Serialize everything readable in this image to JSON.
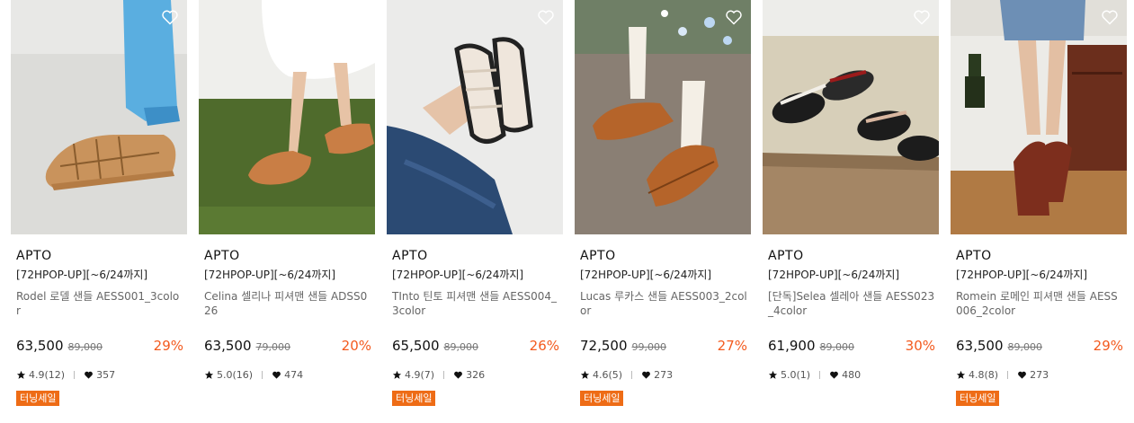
{
  "products": [
    {
      "brand": "APTO",
      "promo": "[72HPOP-UP][~6/24까지]",
      "name": "Rodel 로델 샌들 AESS001_3color",
      "price": "63,500",
      "original_price": "89,000",
      "discount": "29%",
      "rating": "4.9(12)",
      "likes": "357",
      "badge": "터닝세일"
    },
    {
      "brand": "APTO",
      "promo": "[72HPOP-UP][~6/24까지]",
      "name": "Celina 셀리나 피셔맨 샌들 ADSS026",
      "price": "63,500",
      "original_price": "79,000",
      "discount": "20%",
      "rating": "5.0(16)",
      "likes": "474",
      "badge": ""
    },
    {
      "brand": "APTO",
      "promo": "[72HPOP-UP][~6/24까지]",
      "name": "TInto 틴토 피셔맨 샌들 AESS004_3color",
      "price": "65,500",
      "original_price": "89,000",
      "discount": "26%",
      "rating": "4.9(7)",
      "likes": "326",
      "badge": "터닝세일"
    },
    {
      "brand": "APTO",
      "promo": "[72HPOP-UP][~6/24까지]",
      "name": "Lucas 루카스 샌들 AESS003_2color",
      "price": "72,500",
      "original_price": "99,000",
      "discount": "27%",
      "rating": "4.6(5)",
      "likes": "273",
      "badge": "터닝세일"
    },
    {
      "brand": "APTO",
      "promo": "[72HPOP-UP][~6/24까지]",
      "name": "[단독]Selea 셀레아 샌들 AESS023_4color",
      "price": "61,900",
      "original_price": "89,000",
      "discount": "30%",
      "rating": "5.0(1)",
      "likes": "480",
      "badge": ""
    },
    {
      "brand": "APTO",
      "promo": "[72HPOP-UP][~6/24까지]",
      "name": "Romein 로메인 피셔맨 샌들 AESS006_2color",
      "price": "63,500",
      "original_price": "89,000",
      "discount": "29%",
      "rating": "4.8(8)",
      "likes": "273",
      "badge": "터닝세일"
    }
  ],
  "colors": {
    "discount": "#f35a1e",
    "badge": "#ee6c16"
  },
  "icons": {
    "wishlist": "heart-outline-icon",
    "rating": "star-icon",
    "likes": "heart-filled-icon"
  }
}
